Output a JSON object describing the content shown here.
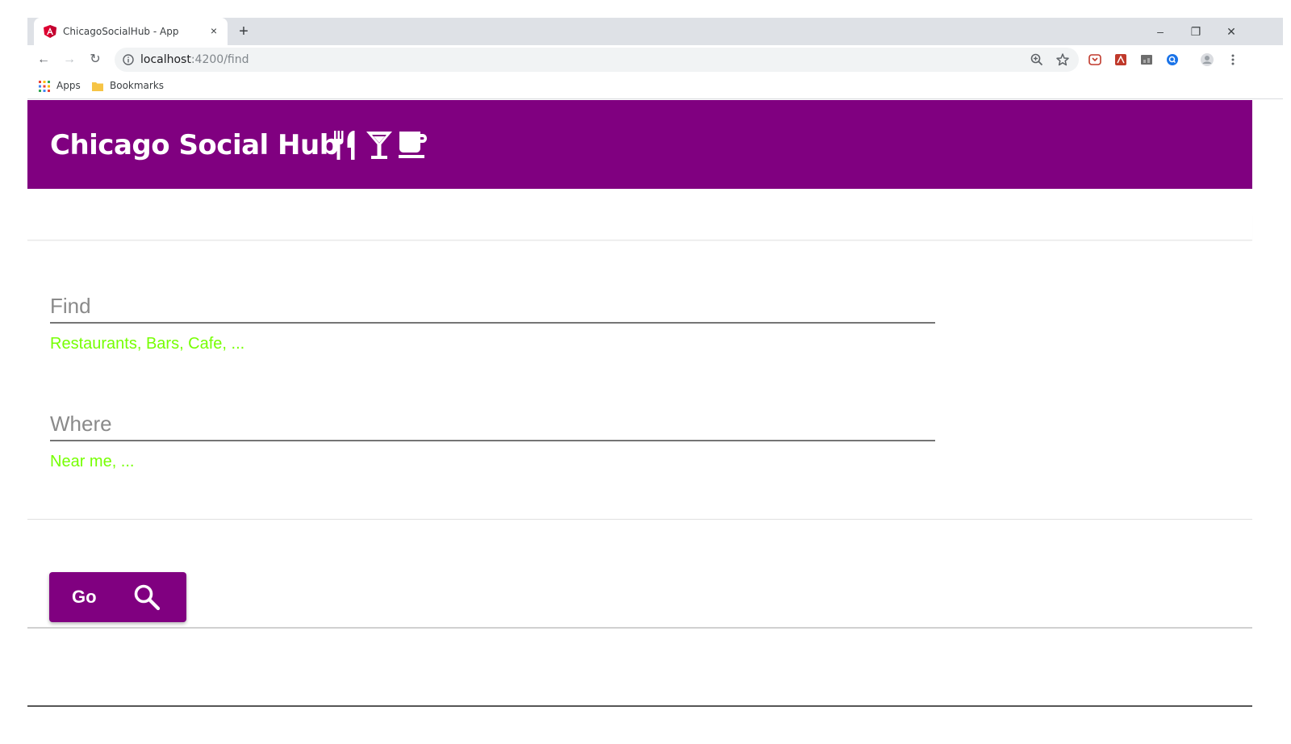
{
  "browser": {
    "tab_title": "ChicagoSocialHub - App",
    "tab_close": "×",
    "new_tab": "+",
    "url_host": "localhost",
    "url_path": ":4200/find",
    "window_controls": {
      "minimize": "–",
      "restore": "❐",
      "close": "✕"
    },
    "nav": {
      "back": "←",
      "forward": "→",
      "reload": "↻"
    },
    "bookmarks": {
      "apps": "Apps",
      "bookmarks": "Bookmarks"
    }
  },
  "header": {
    "title": "Chicago Social Hub",
    "icons": [
      "restaurant-icon",
      "bar-icon",
      "cafe-icon"
    ],
    "background": "#800080"
  },
  "form": {
    "find": {
      "placeholder": "Find",
      "value": "",
      "hint": "Restaurants, Bars, Cafe, ..."
    },
    "where": {
      "placeholder": "Where",
      "value": "",
      "hint": "Near me, ..."
    }
  },
  "go_button": {
    "label": "Go",
    "icon": "search-icon"
  },
  "colors": {
    "accent": "#800080",
    "hint": "#76ff03"
  }
}
